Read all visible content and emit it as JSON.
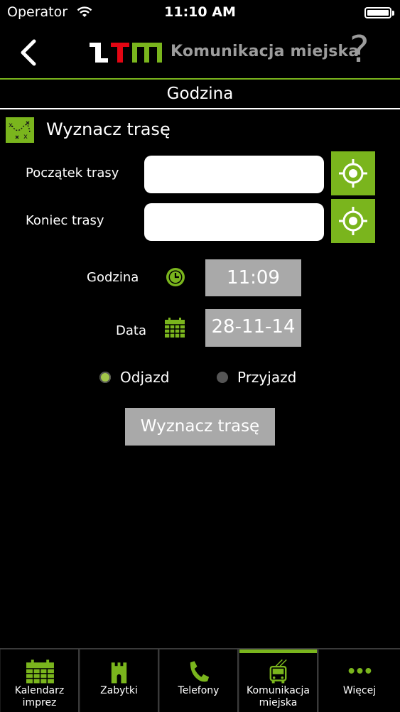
{
  "status_bar": {
    "carrier": "Operator",
    "time": "11:10 AM"
  },
  "nav": {
    "brand_text": "Komunikacja miejska",
    "help": "?"
  },
  "tab_title": "Godzina",
  "section": {
    "title": "Wyznacz trasę"
  },
  "form": {
    "start_label": "Początek trasy",
    "start_value": "",
    "end_label": "Koniec trasy",
    "end_value": "",
    "time_label": "Godzina",
    "time_value": "11:09",
    "date_label": "Data",
    "date_value": "28-11-14",
    "radio_departure": "Odjazd",
    "radio_arrival": "Przyjazd",
    "selected": "departure",
    "submit_label": "Wyznacz trasę"
  },
  "tabbar": {
    "items": [
      {
        "label": "Kalendarz\nimprez",
        "icon": "calendar-icon"
      },
      {
        "label": "Zabytki",
        "icon": "castle-icon"
      },
      {
        "label": "Telefony",
        "icon": "phone-icon"
      },
      {
        "label": "Komunikacja\nmiejska",
        "icon": "trolleybus-icon",
        "active": true
      },
      {
        "label": "Więcej",
        "icon": "more-dots-icon"
      }
    ]
  },
  "colors": {
    "accent": "#7ab51d",
    "gray": "#a9a9a9",
    "background": "#000000"
  }
}
